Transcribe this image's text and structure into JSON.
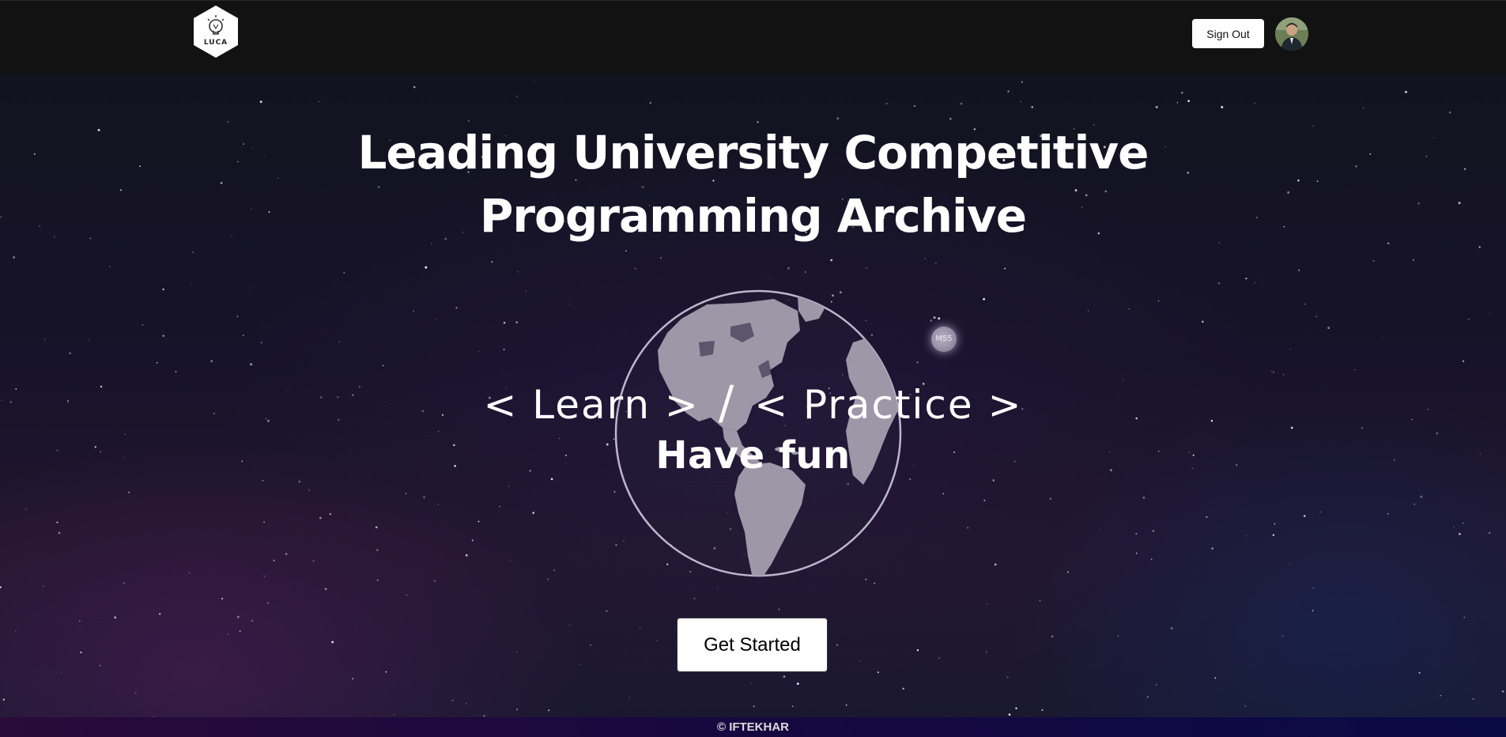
{
  "navbar": {
    "logo_text": "LUCA",
    "signout_label": "Sign Out"
  },
  "hero": {
    "title": "Leading University Competitive Programming Archive",
    "tagline_learn": "< Learn >",
    "tagline_slash": "/",
    "tagline_practice": "< Practice >",
    "subtag": "Have fun",
    "moon_label": "M55",
    "cta_label": "Get Started"
  },
  "footer": {
    "text": "© IFTEKHAR"
  },
  "colors": {
    "navbar_bg": "#121212",
    "button_bg": "#ffffff",
    "footer_gradient_start": "#2a0b3a",
    "footer_gradient_end": "#0a0a45"
  },
  "icons": {
    "logo": "luca-hexagon-logo-icon",
    "avatar": "user-avatar-icon",
    "globe": "globe-americas-icon",
    "moon": "moon-icon"
  }
}
